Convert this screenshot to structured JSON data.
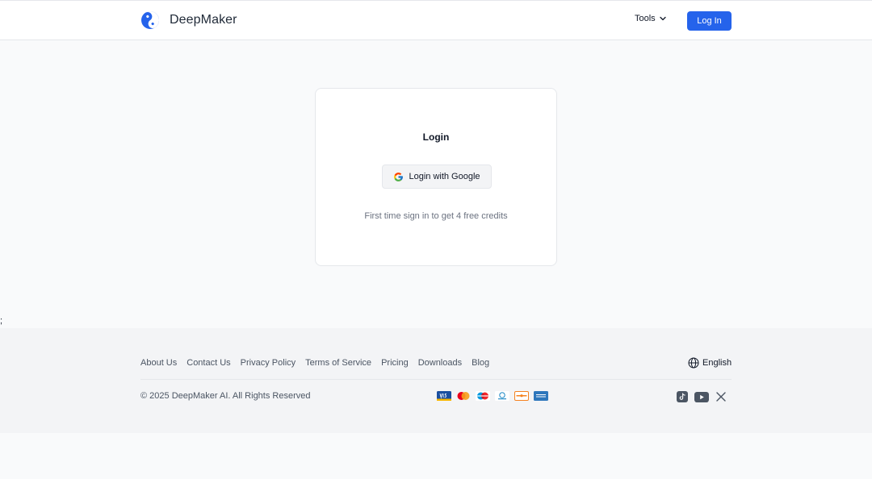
{
  "header": {
    "brand": "DeepMaker",
    "tools_label": "Tools",
    "login_label": "Log In"
  },
  "login_card": {
    "title": "Login",
    "google_button_label": "Login with Google",
    "note": "First time sign in to get 4 free credits"
  },
  "stray_text": ";",
  "footer": {
    "links": [
      "About Us",
      "Contact Us",
      "Privacy Policy",
      "Terms of Service",
      "Pricing",
      "Downloads",
      "Blog"
    ],
    "language": "English",
    "copyright": "© 2025 DeepMaker AI. All Rights Reserved",
    "payment_icons": [
      "visa-icon",
      "mastercard-icon",
      "maestro-icon",
      "diners-club-icon",
      "discover-icon",
      "amex-icon"
    ],
    "social_icons": [
      "tiktok-icon",
      "youtube-icon",
      "x-icon"
    ]
  },
  "colors": {
    "accent": "#2563eb",
    "page_bg": "#f9fafb",
    "footer_bg": "#f3f4f6",
    "muted_text": "#6b7280"
  }
}
